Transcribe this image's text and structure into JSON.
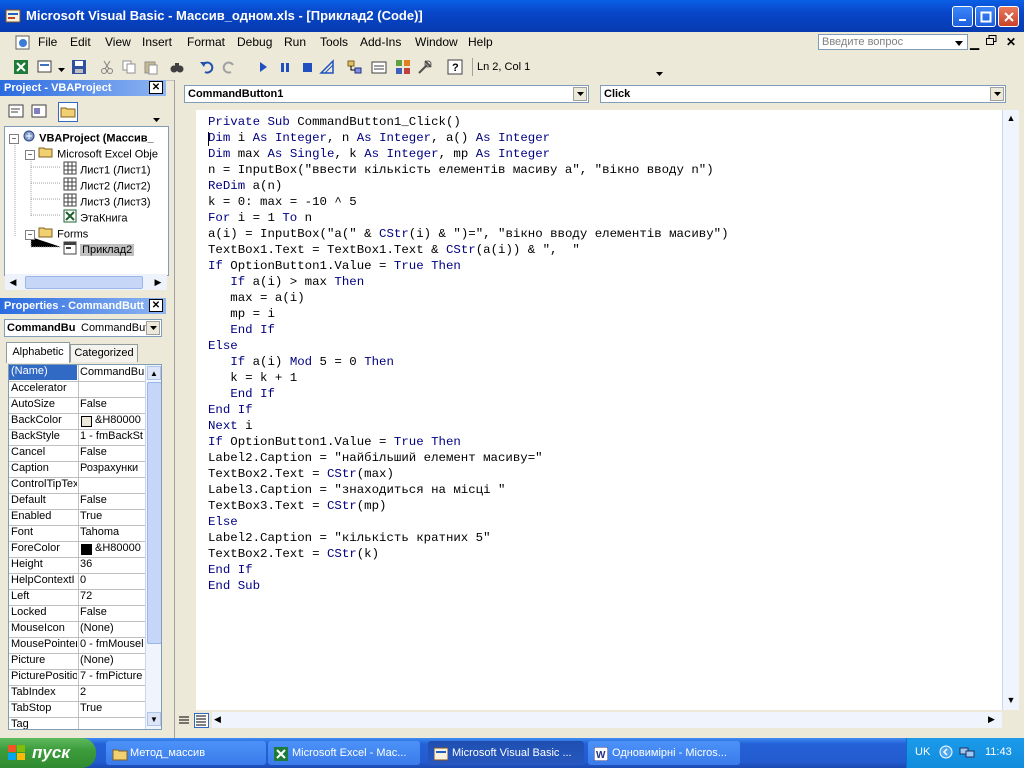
{
  "window": {
    "title": "Microsoft Visual Basic - Массив_одном.xls - [Приклад2 (Code)]"
  },
  "menu": [
    "File",
    "Edit",
    "View",
    "Insert",
    "Format",
    "Debug",
    "Run",
    "Tools",
    "Add-Ins",
    "Window",
    "Help"
  ],
  "ask_placeholder": "Введите вопрос",
  "status": {
    "position": "Ln 2, Col 1"
  },
  "project": {
    "title": "Project - VBAProject",
    "root": "VBAProject (Массив_",
    "excel_objects": "Microsoft Excel Obje",
    "sheets": [
      "Лист1 (Лист1)",
      "Лист2 (Лист2)",
      "Лист3 (Лист3)"
    ],
    "workbook": "ЭтаКнига",
    "forms_folder": "Forms",
    "form": "Приклад2"
  },
  "properties": {
    "title": "Properties - CommandButt",
    "object_name": "CommandBu",
    "object_type": "CommandBut",
    "tab_alpha": "Alphabetic",
    "tab_cat": "Categorized",
    "rows": [
      {
        "name": "(Name)",
        "value": "CommandBu"
      },
      {
        "name": "Accelerator",
        "value": ""
      },
      {
        "name": "AutoSize",
        "value": "False"
      },
      {
        "name": "BackColor",
        "value": "&H80000"
      },
      {
        "name": "BackStyle",
        "value": "1 - fmBackSt"
      },
      {
        "name": "Cancel",
        "value": "False"
      },
      {
        "name": "Caption",
        "value": "Розрахунки"
      },
      {
        "name": "ControlTipTex",
        "value": ""
      },
      {
        "name": "Default",
        "value": "False"
      },
      {
        "name": "Enabled",
        "value": "True"
      },
      {
        "name": "Font",
        "value": "Tahoma"
      },
      {
        "name": "ForeColor",
        "value": "&H80000"
      },
      {
        "name": "Height",
        "value": "36"
      },
      {
        "name": "HelpContextI",
        "value": "0"
      },
      {
        "name": "Left",
        "value": "72"
      },
      {
        "name": "Locked",
        "value": "False"
      },
      {
        "name": "MouseIcon",
        "value": "(None)"
      },
      {
        "name": "MousePointer",
        "value": "0 - fmMousel"
      },
      {
        "name": "Picture",
        "value": "(None)"
      },
      {
        "name": "PicturePosition",
        "value": "7 - fmPicture"
      },
      {
        "name": "TabIndex",
        "value": "2"
      },
      {
        "name": "TabStop",
        "value": "True"
      },
      {
        "name": "Tag",
        "value": ""
      }
    ]
  },
  "code": {
    "object_combo": "CommandButton1",
    "proc_combo": "Click",
    "lines": [
      "Private Sub CommandButton1_Click()",
      "Dim i As Integer, n As Integer, a() As Integer",
      "Dim max As Single, k As Integer, mp As Integer",
      "n = InputBox(\"ввести кількість елементів масиву а\", \"вікно вводу n\")",
      "ReDim a(n)",
      "k = 0: max = -10 ^ 5",
      "For i = 1 To n",
      "a(i) = InputBox(\"a(\" & CStr(i) & \")=\", \"вікно вводу елементів масиву\")",
      "TextBox1.Text = TextBox1.Text & CStr(a(i)) & \",  \"",
      "If OptionButton1.Value = True Then",
      "   If a(i) > max Then",
      "   max = a(i)",
      "   mp = i",
      "   End If",
      "Else",
      "   If a(i) Mod 5 = 0 Then",
      "   k = k + 1",
      "   End If",
      "End If",
      "Next i",
      "If OptionButton1.Value = True Then",
      "Label2.Caption = \"найбільший елемент масиву=\"",
      "TextBox2.Text = CStr(max)",
      "Label3.Caption = \"знаходиться на місці \"",
      "TextBox3.Text = CStr(mp)",
      "Else",
      "Label2.Caption = \"кількість кратних 5\"",
      "TextBox2.Text = CStr(k)",
      "End If",
      "End Sub"
    ]
  },
  "taskbar": {
    "start": "пуск",
    "tasks": [
      "Метод_массив",
      "Microsoft Excel - Мас...",
      "Microsoft Visual Basic ...",
      "Одновимірні - Micros..."
    ],
    "lang": "UK",
    "clock": "11:43"
  },
  "colors": {
    "keyword": "#000080",
    "titlebar": "#0A5FE6",
    "selection": "#316AC5"
  }
}
